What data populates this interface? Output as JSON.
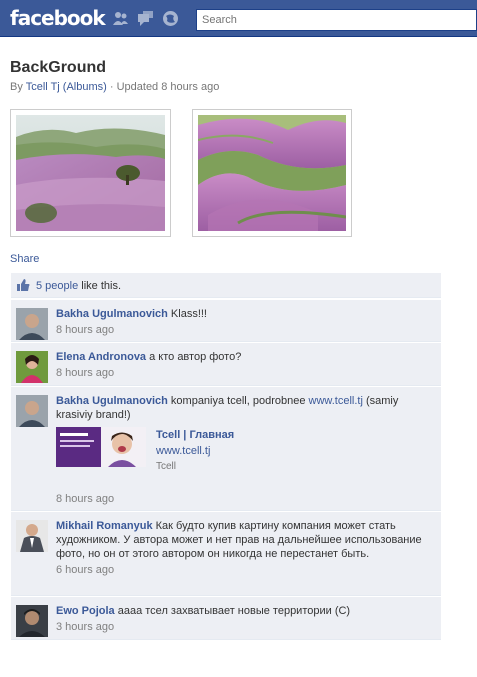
{
  "header": {
    "logo": "facebook",
    "search_placeholder": "Search",
    "icons": [
      "friends-icon",
      "messages-icon",
      "notifications-icon"
    ]
  },
  "album": {
    "title": "BackGround",
    "by_prefix": "By ",
    "author": "Tcell Tj",
    "albums_link": "(Albums)",
    "updated": " · Updated 8 hours ago"
  },
  "photos": [
    {
      "description": "lavender hills"
    },
    {
      "description": "lavender valleys"
    }
  ],
  "share_label": "Share",
  "likes": {
    "count_link": "5 people",
    "suffix": " like this."
  },
  "comments": [
    {
      "author": "Bakha Ugulmanovich",
      "text": " Klass!!!",
      "time": "8 hours ago"
    },
    {
      "author": "Elena Andronova",
      "text": " а кто автор фото?",
      "time": "8 hours ago"
    },
    {
      "author": "Bakha Ugulmanovich",
      "text_before": " kompaniya tcell, podrobnee ",
      "link": "www.tcell.tj",
      "text_after": " (samiy krasiviy brand!)",
      "attachment": {
        "title": "Tcell | Главная",
        "url": "www.tcell.tj",
        "source": "Tcell"
      },
      "time": "8 hours ago"
    },
    {
      "author": "Mikhail Romanyuk",
      "text": " Как будто купив картину компания может стать художником. У автора может и нет прав на дальнейшее использование фото, но он от этого автором он никогда не перестанет быть.",
      "time": "6 hours ago"
    },
    {
      "author": "Ewo Pojola",
      "text": " аааа тсел захватывает новые территории (С)",
      "time": "3 hours ago"
    }
  ]
}
